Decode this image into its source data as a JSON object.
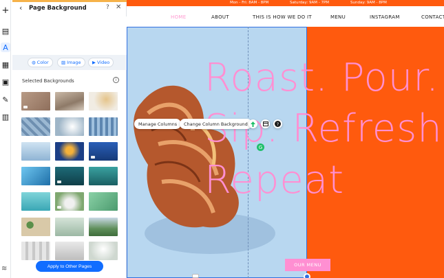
{
  "toolbar": {
    "items": [
      {
        "name": "add-icon",
        "glyph": "+"
      },
      {
        "name": "pages-icon",
        "glyph": "▤"
      },
      {
        "name": "design-icon",
        "glyph": "A"
      },
      {
        "name": "apps-icon",
        "glyph": "▦"
      },
      {
        "name": "media-icon",
        "glyph": "▣"
      },
      {
        "name": "pen-icon",
        "glyph": "✎"
      },
      {
        "name": "business-icon",
        "glyph": "▥"
      }
    ],
    "layers_glyph": "≋"
  },
  "panel": {
    "title": "Page Background",
    "back_glyph": "‹",
    "help_glyph": "?",
    "close_glyph": "✕",
    "type_buttons": [
      {
        "label": "Color",
        "glyph": "◍"
      },
      {
        "label": "Image",
        "glyph": "▨"
      },
      {
        "label": "Video",
        "glyph": "▶"
      }
    ],
    "selected_label": "Selected Backgrounds",
    "info_glyph": "i",
    "apply_label": "Apply to Other Pages"
  },
  "site": {
    "topbar_left": "Mon - Fri: 8AM - 8PM",
    "topbar_mid": "Saturday: 9AM - 7PM",
    "topbar_right": "Sunday: 9AM - 8PM",
    "nav": [
      "HOME",
      "ABOUT",
      "THIS IS HOW WE DO IT",
      "MENU",
      "INSTAGRAM",
      "CONTACT"
    ],
    "hero_lines": [
      "Roast. Pour.",
      "Sip. Refresh.",
      "Repeat"
    ],
    "manage_columns": "Manage Columns",
    "change_column_bg": "Change Column Background",
    "menu_button": "OUR MENU"
  },
  "colors": {
    "accent": "#116dff",
    "orange": "#ff5a0e",
    "pink": "#ff8fd2",
    "sky": "#b8d7f0"
  }
}
